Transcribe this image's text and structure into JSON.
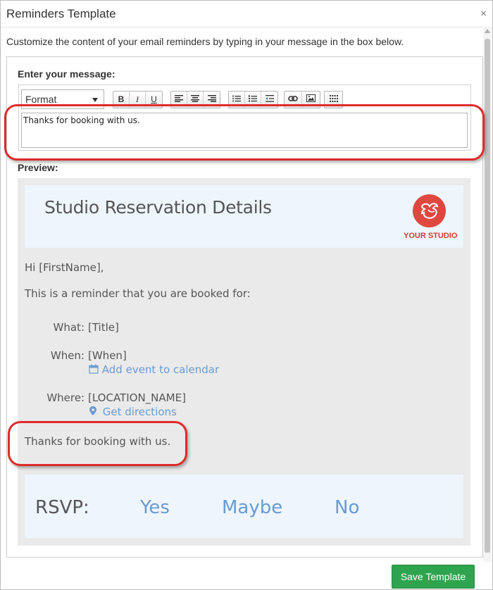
{
  "dialog": {
    "title": "Reminders Template",
    "close_glyph": "×",
    "intro": "Customize the content of your email reminders by typing in your message in the box below.",
    "message_label": "Enter your message:",
    "preview_label": "Preview:",
    "save_label": "Save Template"
  },
  "toolbar": {
    "format_value": "Format",
    "bold": "B",
    "italic": "I",
    "underline": "U"
  },
  "editor": {
    "value": "Thanks for booking with us."
  },
  "preview": {
    "title": "Studio Reservation Details",
    "logo_text": "YOUR STUDIO",
    "greeting": "Hi [FirstName],",
    "intro": "This is a reminder that you are booked for:",
    "what_label": "What:",
    "what_value": "[Title]",
    "when_label": "When:",
    "when_value": "[When]",
    "add_calendar": "Add event to calendar",
    "where_label": "Where:",
    "where_value": "[LOCATION_NAME]",
    "directions": "Get directions",
    "message": "Thanks for booking with us.",
    "rsvp_label": "RSVP:",
    "rsvp_yes": "Yes",
    "rsvp_maybe": "Maybe",
    "rsvp_no": "No"
  },
  "colors": {
    "accent_red": "#e02a2a",
    "save_green": "#2ea44f",
    "link_blue": "#6a9bd2",
    "logo_red": "#e0473f"
  }
}
